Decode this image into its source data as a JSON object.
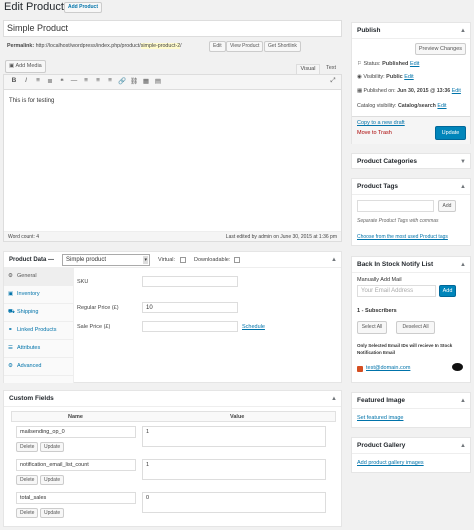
{
  "header": {
    "title": "Edit Product",
    "add_button": "Add Product"
  },
  "post": {
    "title": "Simple Product",
    "permalink_label": "Permalink:",
    "permalink_base": "http://localhost/wordpress/index.php/product/",
    "permalink_slug": "simple-product-2",
    "permalink_end": "/",
    "edit_btn": "Edit",
    "view_btn": "View Product",
    "shortlink_btn": "Get Shortlink"
  },
  "editor": {
    "add_media": "Add Media",
    "tab_visual": "Visual",
    "tab_text": "Text",
    "toolbar": [
      "B",
      "I",
      "≡",
      "≣",
      "❝",
      "—",
      "≡",
      "≡",
      "≡",
      "🔗",
      "⛓",
      "▦",
      "▤"
    ],
    "content": "This is for testing",
    "word_count": "Word count: 4",
    "last_edited": "Last edited by admin on June 30, 2015 at 1:36 pm"
  },
  "product_data": {
    "label": "Product Data —",
    "type": "Simple product",
    "virtual": "Virtual:",
    "downloadable": "Downloadable:",
    "tabs": [
      {
        "label": "General",
        "icon": "wrench-icon",
        "glyph": "⚙"
      },
      {
        "label": "Inventory",
        "icon": "inventory-icon",
        "glyph": "▣"
      },
      {
        "label": "Shipping",
        "icon": "truck-icon",
        "glyph": "⛟"
      },
      {
        "label": "Linked Products",
        "icon": "link-icon",
        "glyph": "⚭"
      },
      {
        "label": "Attributes",
        "icon": "list-icon",
        "glyph": "☰"
      },
      {
        "label": "Advanced",
        "icon": "gear-icon",
        "glyph": "⚙"
      }
    ],
    "sku_label": "SKU",
    "sku_value": "",
    "regular_price_label": "Regular Price (£)",
    "regular_price": "10",
    "sale_price_label": "Sale Price (£)",
    "sale_price": "",
    "schedule": "Schedule"
  },
  "custom_fields": {
    "title": "Custom Fields",
    "col_name": "Name",
    "col_value": "Value",
    "delete": "Delete",
    "update": "Update",
    "rows": [
      {
        "name": "mailsending_op_0",
        "value": "1"
      },
      {
        "name": "notification_email_list_count",
        "value": "1"
      },
      {
        "name": "total_sales",
        "value": "0"
      }
    ]
  },
  "publish": {
    "title": "Publish",
    "preview": "Preview Changes",
    "status_label": "Status:",
    "status_value": "Published",
    "visibility_label": "Visibility:",
    "visibility_value": "Public",
    "published_label": "Published on:",
    "published_value": "Jun 30, 2015 @ 13:36",
    "catalog_label": "Catalog visibility:",
    "catalog_value": "Catalog/search",
    "edit": "Edit",
    "copy_draft": "Copy to a new draft",
    "trash": "Move to Trash",
    "update": "Update"
  },
  "product_categories": {
    "title": "Product Categories"
  },
  "product_tags": {
    "title": "Product Tags",
    "add": "Add",
    "hint": "Separate Product Tags with commas",
    "choose": "Choose from the most used Product tags"
  },
  "notify": {
    "title": "Back In Stock Notify List",
    "manual_label": "Manually Add Mail",
    "placeholder": "Your Email Address",
    "add": "Add",
    "subscribers": "1 - Subscribers",
    "select_all": "Select All",
    "deselect_all": "Deselect All",
    "note": "Only Selected Email IDs will recieve In Stock Notification Email",
    "email": "test@domain.com"
  },
  "featured": {
    "title": "Featured Image",
    "link": "Set featured image"
  },
  "gallery": {
    "title": "Product Gallery",
    "link": "Add product gallery images"
  },
  "colors": {
    "accent": "#0085ba",
    "trash": "#a00",
    "link": "#0073aa"
  }
}
